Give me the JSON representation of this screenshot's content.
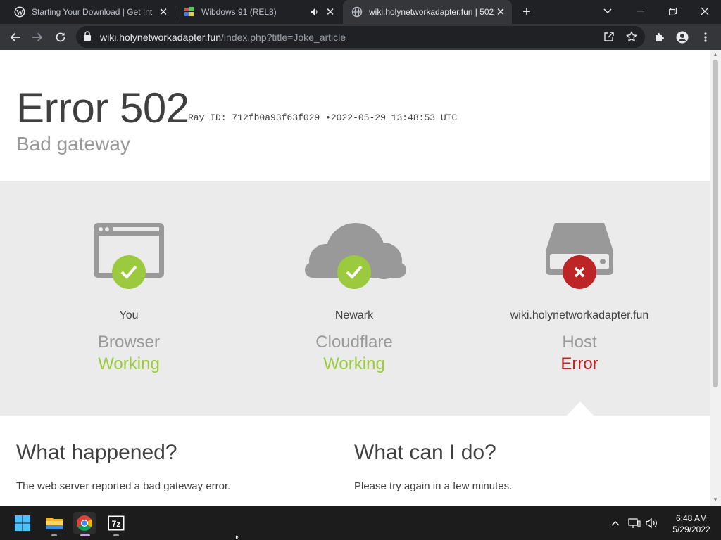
{
  "browser": {
    "tabs": [
      {
        "title": "Starting Your Download | Get Int",
        "favicon": "wordpress-icon",
        "active": false,
        "audio": false
      },
      {
        "title": "Wibdows 91 (REL8)",
        "favicon": "wibdows-icon",
        "active": false,
        "audio": true
      },
      {
        "title": "wiki.holynetworkadapter.fun | 502",
        "favicon": "globe-icon",
        "active": true,
        "audio": false
      }
    ],
    "new_tab_glyph": "+",
    "address_host": "wiki.holynetworkadapter.fun",
    "address_path": "/index.php?title=Joke_article"
  },
  "page": {
    "error_title": "Error 502",
    "ray_label": "Ray ID: 712fb0a93f63f029",
    "ray_sep": "•",
    "ray_time": "2022-05-29 13:48:53 UTC",
    "subtitle": "Bad gateway",
    "status": [
      {
        "location": "You",
        "kind": "Browser",
        "state": "Working",
        "ok": true,
        "icon": "browser-icon"
      },
      {
        "location": "Newark",
        "kind": "Cloudflare",
        "state": "Working",
        "ok": true,
        "icon": "cloud-icon"
      },
      {
        "location": "wiki.holynetworkadapter.fun",
        "kind": "Host",
        "state": "Error",
        "ok": false,
        "icon": "server-icon"
      }
    ],
    "what_happened": {
      "heading": "What happened?",
      "text": "The web server reported a bad gateway error."
    },
    "what_can_i_do": {
      "heading": "What can I do?",
      "text": "Please try again in a few minutes."
    },
    "colors": {
      "ok": "#9bca3e",
      "error": "#bd2426",
      "band": "#ebebeb",
      "text": "#404040",
      "muted": "#999999"
    }
  },
  "taskbar": {
    "apps": [
      "start-icon",
      "file-explorer-icon",
      "chrome-icon",
      "7zip-icon"
    ],
    "time": "6:48 AM",
    "date": "5/29/2022"
  }
}
